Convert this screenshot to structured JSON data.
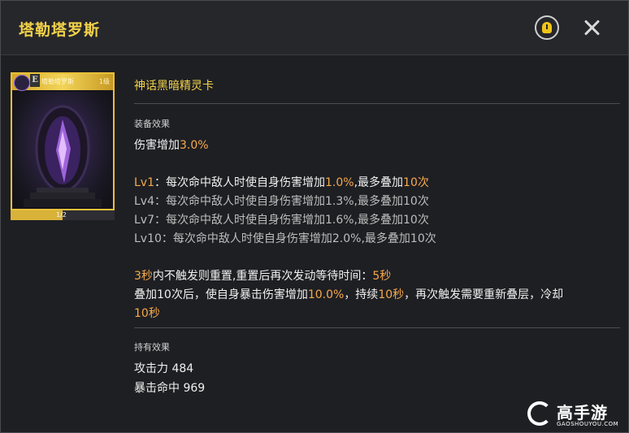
{
  "header": {
    "title": "塔勒塔罗斯"
  },
  "card": {
    "name": "塔勒塔罗斯",
    "grade": "E",
    "level": "1级",
    "progress_text": "1/2",
    "progress_value": 0.5
  },
  "details": {
    "card_title": "神话黑暗精灵卡",
    "equip_label": "装备效果",
    "equip_effect_prefix": "伤害增加",
    "equip_effect_value": "3.0%",
    "lv1_prefix": "Lv1",
    "lv1_text_a": "：每次命中敌人时使自身伤害增加",
    "lv1_value": "1.0%",
    "lv1_text_b": ",最多叠加",
    "lv1_stack": "10次",
    "lv4": "Lv4：每次命中敌人时使自身伤害增加1.3%,最多叠加10次",
    "lv7": "Lv7：每次命中敌人时使自身伤害增加1.6%,最多叠加10次",
    "lv10": "Lv10：每次命中敌人时使自身伤害增加2.0%,最多叠加10次",
    "reset_sec": "3秒",
    "reset_text": "内不触发则重置,重置后再次发动等待时间：",
    "wait_sec": "5秒",
    "stack_text_a": "叠加10次后，使自身暴击伤害增加",
    "stack_value": "10.0%",
    "stack_text_b": "，持续",
    "stack_duration": "10秒",
    "stack_text_c": "，再次触发需要重新叠层，冷却",
    "cooldown": "10秒",
    "hold_label": "持有效果",
    "attack_label": "攻击力",
    "attack_value": "484",
    "crit_label": "暴击命中",
    "crit_value": "969"
  },
  "watermark": {
    "name": "高手游",
    "domain": "GAOSHOUYOU.COM"
  },
  "colors": {
    "accent_yellow": "#f3d34a",
    "highlight_orange": "#f7a94b",
    "background": "#1e1f23"
  },
  "icons": [
    "lightbulb-hint-icon",
    "close-icon",
    "card-class-icon",
    "gaoshouyou-logo-icon"
  ]
}
